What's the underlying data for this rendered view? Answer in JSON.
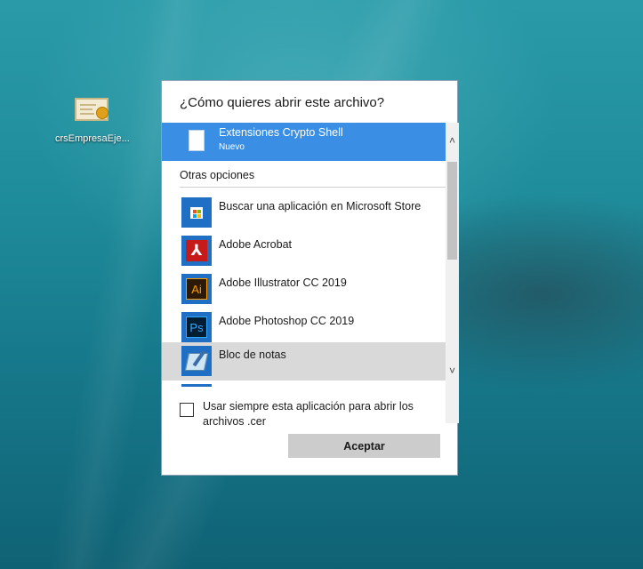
{
  "desktop": {
    "icon_label": "crsEmpresaEje...",
    "icon_name": "certificate-file-icon"
  },
  "dialog": {
    "title": "¿Cómo quieres abrir este archivo?",
    "selected_app": {
      "name": "Extensiones Crypto Shell",
      "sub": "Nuevo",
      "icon": "blank-document-icon"
    },
    "section_label": "Otras opciones",
    "apps": [
      {
        "name": "Buscar una aplicación en Microsoft Store",
        "icon": "microsoft-store-icon"
      },
      {
        "name": "Adobe Acrobat",
        "icon": "adobe-acrobat-icon",
        "glyph": "⅄"
      },
      {
        "name": "Adobe Illustrator CC 2019",
        "icon": "adobe-illustrator-icon",
        "glyph": "Ai"
      },
      {
        "name": "Adobe Photoshop CC 2019",
        "icon": "adobe-photoshop-icon",
        "glyph": "Ps"
      },
      {
        "name": "Bloc de notas",
        "icon": "notepad-icon"
      }
    ],
    "checkbox": {
      "label": "Usar siempre esta aplicación para abrir los archivos .cer",
      "checked": false
    },
    "ok_label": "Aceptar",
    "scroll_up": "˄",
    "scroll_down": "˅"
  },
  "colors": {
    "selection": "#3a8ee3",
    "hover": "#d9d9d9",
    "button": "#cccccc"
  }
}
